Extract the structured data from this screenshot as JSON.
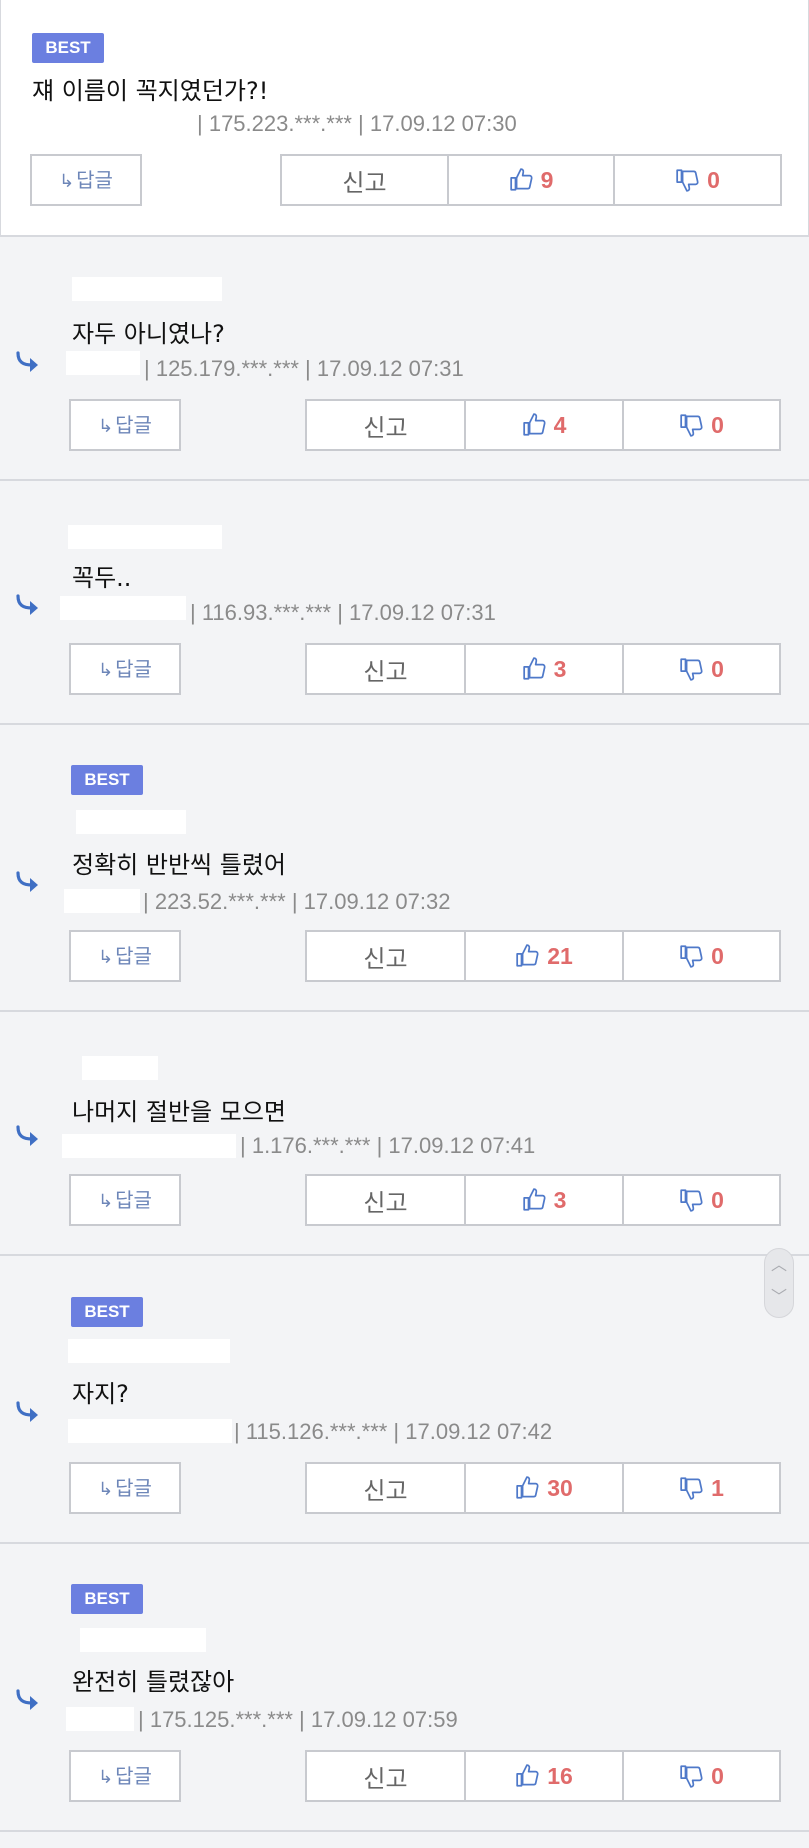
{
  "best_label": "BEST",
  "reply_label": "답글",
  "report_label": "신고",
  "colors": {
    "best_badge": "#6b7fe0",
    "vote_count": "#e06b6b",
    "reply_text": "#6d86b8",
    "arrow": "#3f6fc4"
  },
  "comments": [
    {
      "best": true,
      "nick": "",
      "text": "쟤 이름이 꼭지였던가?!",
      "meta": "| 175.223.***.*** | 17.09.12 07:30",
      "up": "9",
      "down": "0",
      "reply": false
    },
    {
      "best": false,
      "nick": "",
      "text": "자두 아니였나?",
      "meta": "| 125.179.***.*** | 17.09.12 07:31",
      "up": "4",
      "down": "0",
      "reply": true
    },
    {
      "best": false,
      "nick": "",
      "text": "꼭두..",
      "meta": "| 116.93.***.*** | 17.09.12 07:31",
      "up": "3",
      "down": "0",
      "reply": true
    },
    {
      "best": true,
      "nick": "",
      "text": "정확히 반반씩 틀렸어",
      "meta": "| 223.52.***.*** | 17.09.12 07:32",
      "up": "21",
      "down": "0",
      "reply": true
    },
    {
      "best": false,
      "nick": "",
      "text": "나머지 절반을 모으면",
      "meta": "| 1.176.***.*** | 17.09.12 07:41",
      "up": "3",
      "down": "0",
      "reply": true
    },
    {
      "best": true,
      "nick": "",
      "text": "자지?",
      "meta": "| 115.126.***.*** | 17.09.12 07:42",
      "up": "30",
      "down": "1",
      "reply": true
    },
    {
      "best": true,
      "nick": "",
      "text": "완전히 틀렸잖아",
      "meta": "| 175.125.***.*** | 17.09.12 07:59",
      "up": "16",
      "down": "0",
      "reply": true
    }
  ],
  "scroll_icons": {
    "up": "chevron-up-icon",
    "down": "chevron-down-icon"
  }
}
